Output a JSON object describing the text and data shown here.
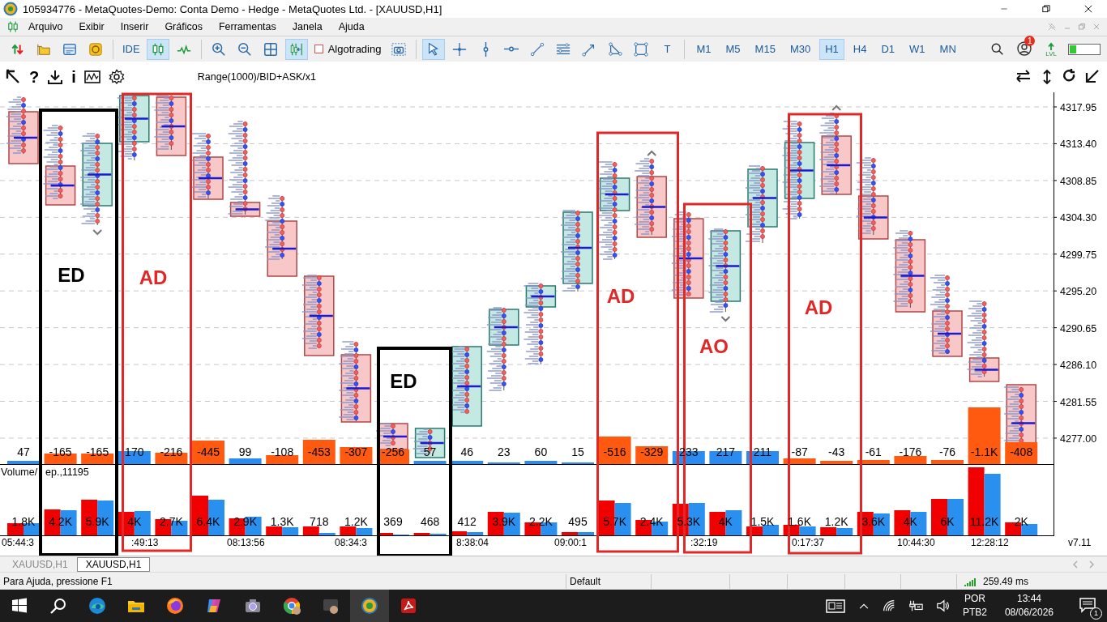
{
  "window": {
    "title": "105934776 - MetaQuotes-Demo: Conta Demo - Hedge - MetaQuotes Ltd. - [XAUUSD,H1]"
  },
  "menu": [
    "Arquivo",
    "Exibir",
    "Inserir",
    "Gráficos",
    "Ferramentas",
    "Janela",
    "Ajuda"
  ],
  "toolbar": {
    "buttons": [
      {
        "selected": false
      },
      {
        "selected": false
      },
      {
        "selected": false
      },
      {
        "selected": false
      },
      {
        "label": "IDE",
        "selected": false
      },
      {
        "selected": true
      },
      {
        "selected": false
      },
      {
        "selected": false
      },
      {
        "selected": false
      },
      {
        "selected": false
      },
      {
        "selected": true
      },
      {
        "label": "Algotrading",
        "checked": false,
        "selected": false
      },
      {
        "selected": false
      },
      {
        "selected": true
      },
      {
        "selected": false
      },
      {
        "selected": false
      },
      {
        "selected": false
      },
      {
        "selected": false
      },
      {
        "selected": false
      },
      {
        "selected": false
      },
      {
        "selected": false
      },
      {
        "selected": false
      },
      {
        "label": "T",
        "selected": false
      }
    ],
    "timeframes": [
      {
        "label": "M1",
        "selected": false
      },
      {
        "label": "M5",
        "selected": false
      },
      {
        "label": "M15",
        "selected": false
      },
      {
        "label": "M30",
        "selected": false
      },
      {
        "label": "H1",
        "selected": true
      },
      {
        "label": "H4",
        "selected": false
      },
      {
        "label": "D1",
        "selected": false
      },
      {
        "label": "W1",
        "selected": false
      },
      {
        "label": "MN",
        "selected": false
      }
    ],
    "notification_count": "1",
    "lvl_label": "LVL",
    "meter": {
      "level": 0.22
    }
  },
  "chart_toolbar": {
    "help_glyph": "?",
    "info_glyph": "i",
    "caption": "Range(1000)/BID+ASK/x1"
  },
  "chart": {
    "price_labels": [
      "4317.95",
      "4313.40",
      "4308.85",
      "4304.30",
      "4299.75",
      "4295.20",
      "4290.65",
      "4286.10",
      "4281.55",
      "4277.00"
    ],
    "deltas": [
      {
        "value": "47",
        "kind": "buy"
      },
      {
        "value": "-165",
        "kind": "sell"
      },
      {
        "value": "-165",
        "kind": "sell"
      },
      {
        "value": "170",
        "kind": "buy"
      },
      {
        "value": "-216",
        "kind": "sell"
      },
      {
        "value": "-445",
        "kind": "sell"
      },
      {
        "value": "99",
        "kind": "buy"
      },
      {
        "value": "-108",
        "kind": "sell"
      },
      {
        "value": "-453",
        "kind": "sell"
      },
      {
        "value": "-307",
        "kind": "sell"
      },
      {
        "value": "-256",
        "kind": "sell"
      },
      {
        "value": "57",
        "kind": "buy"
      },
      {
        "value": "46",
        "kind": "buy"
      },
      {
        "value": "23",
        "kind": "buy"
      },
      {
        "value": "60",
        "kind": "buy"
      },
      {
        "value": "15",
        "kind": "buy"
      },
      {
        "value": "-516",
        "kind": "sell"
      },
      {
        "value": "-329",
        "kind": "sell"
      },
      {
        "value": "233",
        "kind": "buy"
      },
      {
        "value": "217",
        "kind": "buy"
      },
      {
        "value": "211",
        "kind": "buy"
      },
      {
        "value": "-87",
        "kind": "sell"
      },
      {
        "value": "-43",
        "kind": "sell"
      },
      {
        "value": "-61",
        "kind": "sell"
      },
      {
        "value": "-176",
        "kind": "sell"
      },
      {
        "value": "-76",
        "kind": "sell"
      },
      {
        "value": "-1.1K",
        "kind": "sell"
      },
      {
        "value": "-408",
        "kind": "sell"
      }
    ],
    "volume_title": [
      "Volume/",
      "ep.,11195"
    ],
    "volumes": [
      "1.8K",
      "4.2K",
      "5.9K",
      "4K",
      "2.7K",
      "6.4K",
      "2.9K",
      "1.3K",
      "718",
      "1.2K",
      "369",
      "468",
      "412",
      "3.9K",
      "2.2K",
      "495",
      "5.7K",
      "2.4K",
      "5.3K",
      "4K",
      "1.5K",
      "1.6K",
      "1.2K",
      "3.6K",
      "4K",
      "6K",
      "11.2K",
      "2K"
    ],
    "time_labels": [
      "05:44:3",
      ":49:13",
      "08:13:56",
      "08:34:3",
      "8:38:04",
      "09:00:1",
      ":32:19",
      "0:17:37",
      "10:44:30",
      "12:28:12",
      "v7.11"
    ],
    "annotations": [
      {
        "label": "ED",
        "color": "#000000"
      },
      {
        "label": "AD",
        "color": "#e02828"
      },
      {
        "label": "ED",
        "color": "#000000"
      },
      {
        "label": "AD",
        "color": "#e02828"
      },
      {
        "label": "AO",
        "color": "#e02828"
      },
      {
        "label": "AD",
        "color": "#e02828"
      }
    ]
  },
  "tabs": [
    {
      "label": "XAUUSD,H1",
      "selected": false
    },
    {
      "label": "XAUUSD,H1",
      "selected": true
    }
  ],
  "status_bar": {
    "help": "Para Ajuda, pressione F1",
    "profile": "Default",
    "ping": "259.49 ms"
  },
  "taskbar": {
    "language": "POR",
    "layout": "PTB2",
    "time": "13:44",
    "date": "08/06/2026",
    "notification_count": "1"
  }
}
